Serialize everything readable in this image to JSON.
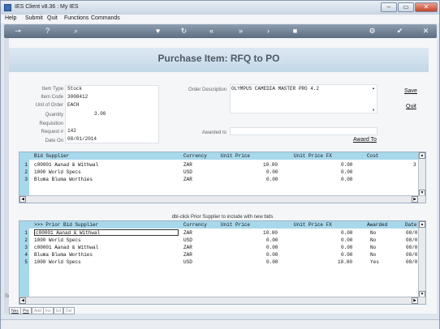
{
  "window": {
    "title": "IES Client v8.36 : My IES",
    "min": "–",
    "max": "▭",
    "close": "✕"
  },
  "menu": [
    "Help",
    "Submit",
    "Quit",
    "Functions",
    "Commands"
  ],
  "toolbar_icons": [
    "key-icon",
    "help-icon",
    "search-icon",
    "heart-icon",
    "refresh-icon",
    "rewind-icon",
    "fast-forward-icon",
    "next-icon",
    "stop-icon",
    "gear-icon",
    "check-icon",
    "close-icon"
  ],
  "header": {
    "title": "Purchase Item: RFQ to PO"
  },
  "form": {
    "item_type_label": "Item Type",
    "item_type": "Stock",
    "item_code_label": "Item Code",
    "item_code": "3008412",
    "unit_label": "Unit of Order",
    "unit": "EACH",
    "quantity_label": "Quantity",
    "quantity": "3.00",
    "requisition_label": "Requisition",
    "requisition": "",
    "request_label": "Request #",
    "request": "142",
    "date_label": "Date On",
    "date": "08/01/2014",
    "order_desc_label": "Order Description",
    "order_desc": "OLYMPUS CAMEDIA MASTER PRO 4.2",
    "awarded_to_label": "Awarded to",
    "awarded_to": ""
  },
  "actions": {
    "save": "Save",
    "quit": "Quit",
    "award_to": "Award To"
  },
  "bids_grid": {
    "columns": [
      "Bid Supplier",
      "Currency",
      "Unit Price",
      "Unit Price FX",
      "Cost"
    ],
    "rows": [
      {
        "n": "1",
        "supplier": "c00001 Aanad & Withwal",
        "currency": "ZAR",
        "price": "10.00",
        "fx": "0.00",
        "cost": "3"
      },
      {
        "n": "2",
        "supplier": "1000 World Specs",
        "currency": "USD",
        "price": "0.00",
        "fx": "0.00",
        "cost": ""
      },
      {
        "n": "3",
        "supplier": "Bluma Bluma Worthies",
        "currency": "ZAR",
        "price": "0.00",
        "fx": "0.00",
        "cost": ""
      }
    ]
  },
  "prior_hint": "dbl-click Prior Supplier to include with new bids",
  "prior_grid": {
    "columns": [
      ">>> Prior Bid Supplier",
      "Currency",
      "Unit Price",
      "Unit Price FX",
      "Awarded",
      "Date"
    ],
    "rows": [
      {
        "n": "1",
        "supplier": "c00001 Aanad & Withwal",
        "currency": "ZAR",
        "price": "10.00",
        "fx": "0.00",
        "awarded": "No",
        "date": "08/0"
      },
      {
        "n": "2",
        "supplier": "1000 World Specs",
        "currency": "USD",
        "price": "0.00",
        "fx": "0.00",
        "awarded": "No",
        "date": "08/0"
      },
      {
        "n": "3",
        "supplier": "c00001 Aanad & Withwal",
        "currency": "ZAR",
        "price": "0.00",
        "fx": "0.00",
        "awarded": "No",
        "date": "08/0"
      },
      {
        "n": "4",
        "supplier": "Bluma Bluma Worthies",
        "currency": "ZAR",
        "price": "0.00",
        "fx": "0.00",
        "awarded": "No",
        "date": "08/0"
      },
      {
        "n": "5",
        "supplier": "1000 World Specs",
        "currency": "USD",
        "price": "0.00",
        "fx": "10.00",
        "awarded": "Yes",
        "date": "08/0"
      }
    ]
  },
  "bottom_tabs": [
    "Nex",
    "Pre",
    "Add",
    "Ins",
    "Ed",
    "Del"
  ],
  "side_label": "Se"
}
